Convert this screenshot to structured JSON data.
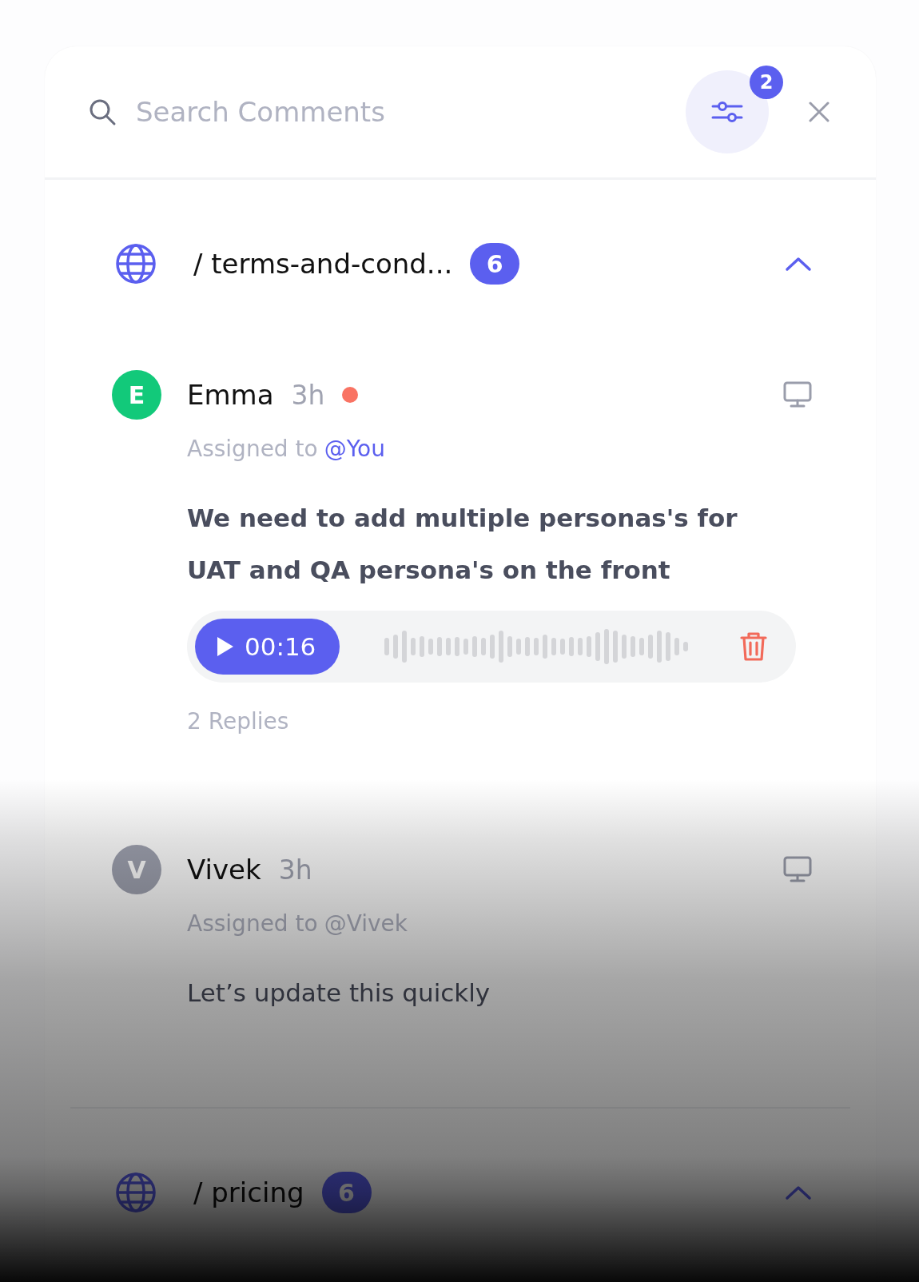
{
  "search": {
    "placeholder": "Search Comments"
  },
  "filter": {
    "count": "2"
  },
  "groups": [
    {
      "path": "/ terms-and-cond...",
      "count": "6",
      "expanded": true,
      "comments": [
        {
          "initial": "E",
          "color": "#12c97a",
          "name": "Emma",
          "time": "3h",
          "unread": true,
          "assigned_label": "Assigned to",
          "mention": "@You",
          "mention_highlighted": true,
          "body": "We need to add multiple personas's for UAT and QA persona's on the front",
          "audio": {
            "duration": "00:16"
          },
          "replies": "2 Replies"
        },
        {
          "initial": "V",
          "color": "#a0a3b1",
          "name": "Vivek",
          "time": "3h",
          "unread": false,
          "assigned_label": "Assigned to",
          "mention": "@Vivek",
          "mention_highlighted": false,
          "body": "Let’s update this quickly"
        }
      ]
    },
    {
      "path": "/ pricing",
      "count": "6",
      "expanded": true
    }
  ]
}
